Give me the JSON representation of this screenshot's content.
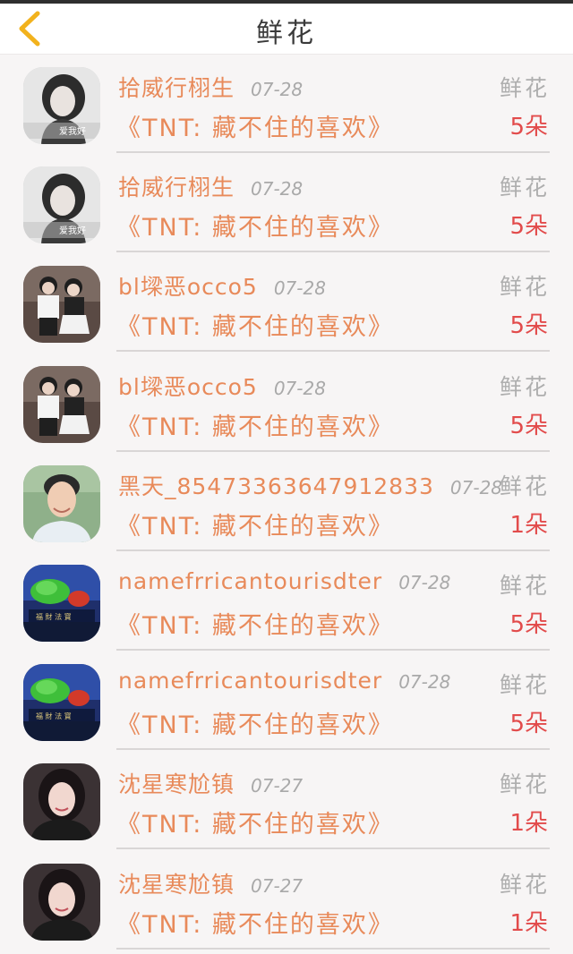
{
  "header": {
    "title": "鲜花",
    "back_icon": "chevron-left-icon",
    "back_color": "#f2b21d"
  },
  "colors": {
    "accent": "#e88a5a",
    "count": "#e24b4b",
    "muted": "#aeaeae"
  },
  "records": [
    {
      "name": "拾威行栩生",
      "date": "07-28",
      "gift": "鲜花",
      "song": "《TNT: 藏不住的喜欢》",
      "count": "5朵",
      "avatar": "girl-gray-photo"
    },
    {
      "name": "拾威行栩生",
      "date": "07-28",
      "gift": "鲜花",
      "song": "《TNT: 藏不住的喜欢》",
      "count": "5朵",
      "avatar": "girl-gray-photo"
    },
    {
      "name": "bl墚恶occo5",
      "date": "07-28",
      "gift": "鲜花",
      "song": "《TNT: 藏不住的喜欢》",
      "count": "5朵",
      "avatar": "couple-photo"
    },
    {
      "name": "bl墚恶occo5",
      "date": "07-28",
      "gift": "鲜花",
      "song": "《TNT: 藏不住的喜欢》",
      "count": "5朵",
      "avatar": "couple-photo"
    },
    {
      "name": "黑天_8547336364791283​3",
      "date": "07-28",
      "gift": "鲜花",
      "song": "《TNT: 藏不住的喜欢》",
      "count": "1朵",
      "avatar": "man-portrait-photo"
    },
    {
      "name": "namefrricantourisdter",
      "date": "07-28",
      "gift": "鲜花",
      "song": "《TNT: 藏不住的喜欢》",
      "count": "5朵",
      "avatar": "green-flower-photo"
    },
    {
      "name": "namefrricantourisdter",
      "date": "07-28",
      "gift": "鲜花",
      "song": "《TNT: 藏不住的喜欢》",
      "count": "5朵",
      "avatar": "green-flower-photo"
    },
    {
      "name": "沈星寒尬镇",
      "date": "07-27",
      "gift": "鲜花",
      "song": "《TNT: 藏不住的喜欢》",
      "count": "1朵",
      "avatar": "girl-dark-photo"
    },
    {
      "name": "沈星寒尬镇",
      "date": "07-27",
      "gift": "鲜花",
      "song": "《TNT: 藏不住的喜欢》",
      "count": "1朵",
      "avatar": "girl-dark-photo"
    }
  ]
}
